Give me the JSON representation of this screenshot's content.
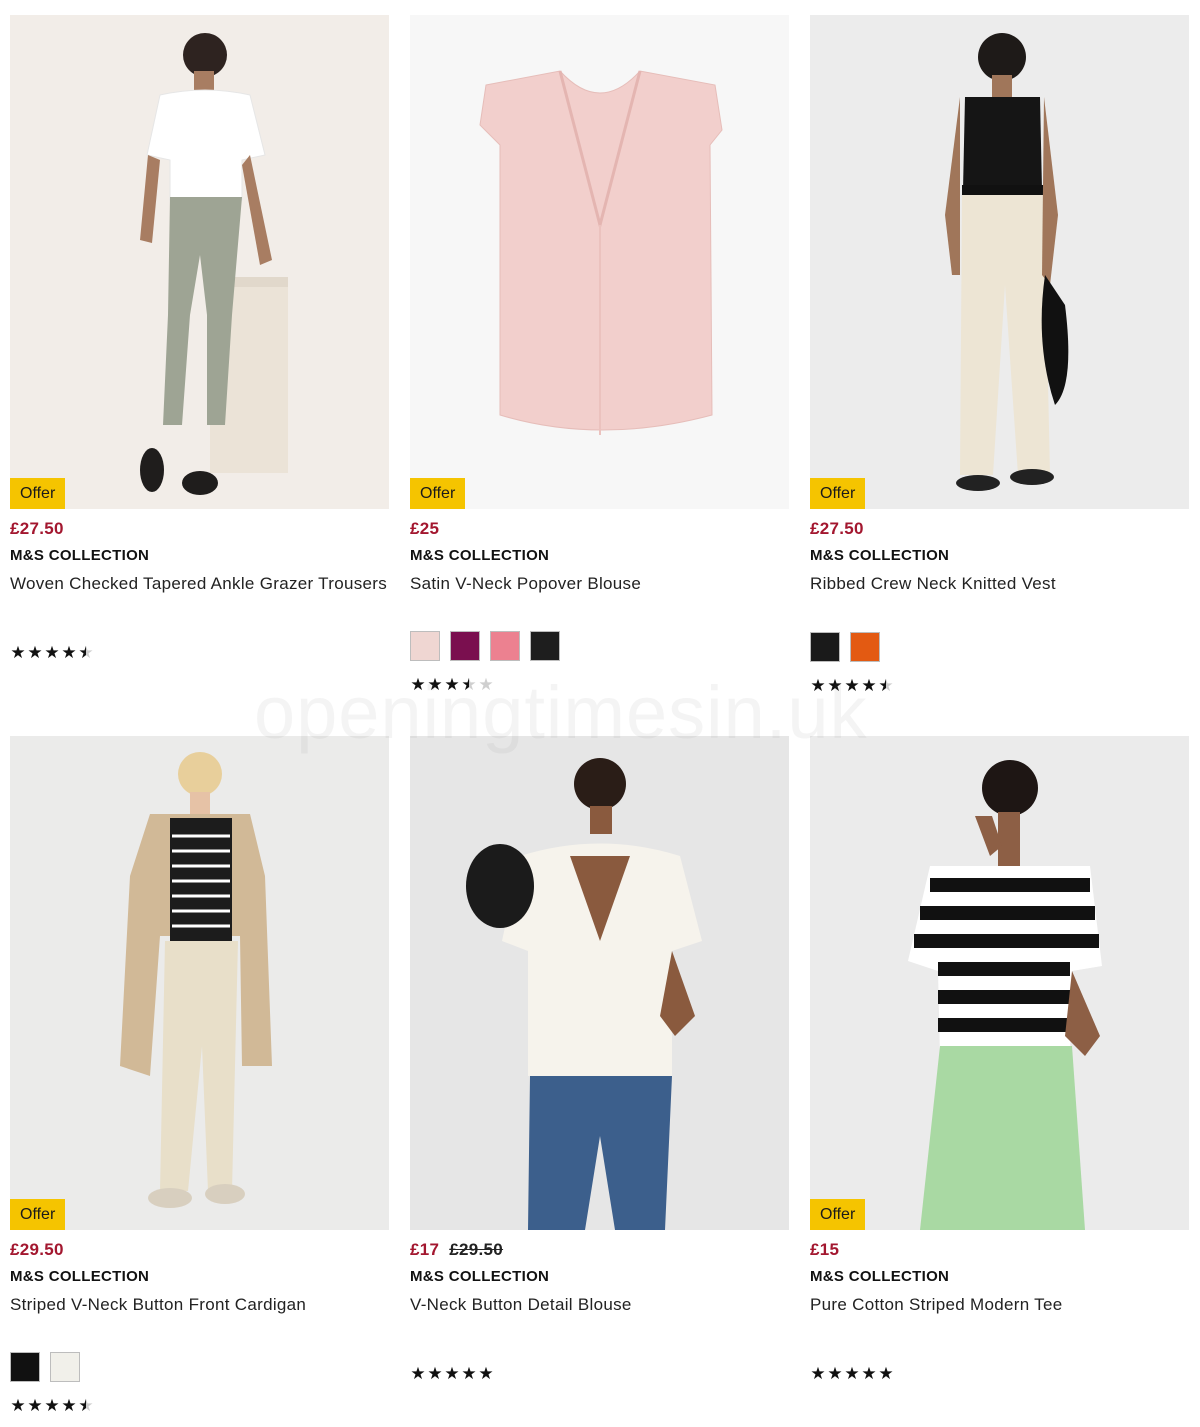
{
  "watermark": "openingtimesin.uk",
  "products": [
    {
      "offer": "Offer",
      "price": "£27.50",
      "was": "",
      "brand": "M&S COLLECTION",
      "title": "Woven Checked Tapered Ankle Grazer Trousers",
      "swatches": [],
      "rating": 4.5
    },
    {
      "offer": "Offer",
      "price": "£25",
      "was": "",
      "brand": "M&S COLLECTION",
      "title": "Satin V-Neck Popover Blouse",
      "swatches": [
        "#efd6d2",
        "#7a0f4f",
        "#ec8190",
        "#1e1e1e"
      ],
      "rating": 3.5
    },
    {
      "offer": "Offer",
      "price": "£27.50",
      "was": "",
      "brand": "M&S COLLECTION",
      "title": "Ribbed Crew Neck Knitted Vest",
      "swatches": [
        "#1a1a1a",
        "#e35a12"
      ],
      "rating": 4.5
    },
    {
      "offer": "Offer",
      "price": "£29.50",
      "was": "",
      "brand": "M&S COLLECTION",
      "title": "Striped V-Neck Button Front Cardigan",
      "swatches": [
        "#111111",
        "#f1f0ea"
      ],
      "rating": 4.5
    },
    {
      "offer": "",
      "price": "£17",
      "was": "£29.50",
      "brand": "M&S COLLECTION",
      "title": "V-Neck Button Detail Blouse",
      "swatches": [],
      "rating": 5
    },
    {
      "offer": "Offer",
      "price": "£15",
      "was": "",
      "brand": "M&S COLLECTION",
      "title": "Pure Cotton Striped Modern Tee",
      "swatches": [],
      "rating": 5
    }
  ],
  "colors": {
    "price": "#a3172f",
    "offer_badge": "#f5c400"
  }
}
